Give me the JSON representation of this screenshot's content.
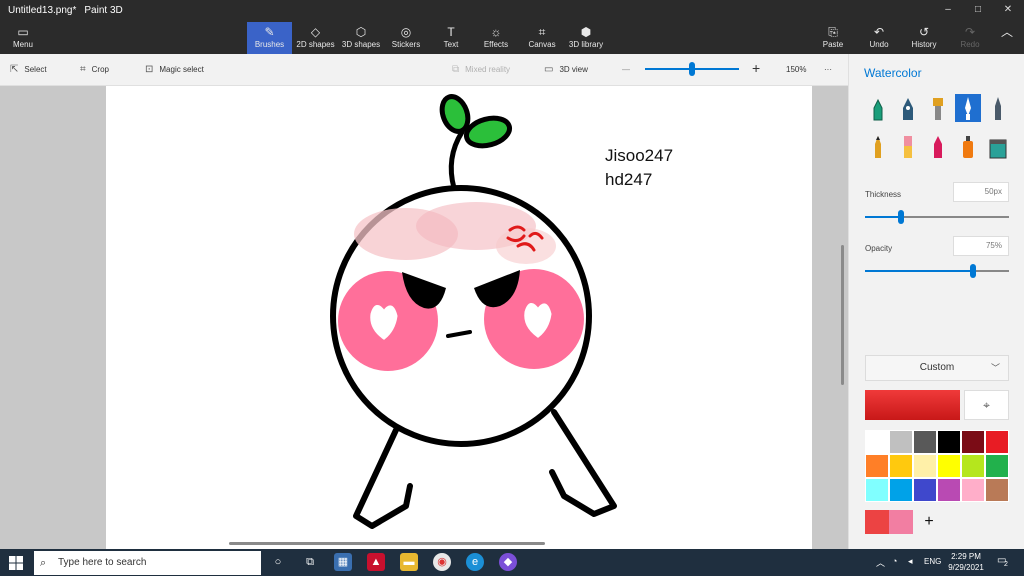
{
  "window": {
    "file_title": "Untitled13.png*",
    "app_name": "Paint 3D",
    "controls": [
      "–",
      "□",
      "✕"
    ]
  },
  "ribbon": {
    "menu": "Menu",
    "tabs": [
      {
        "label": "Brushes",
        "icon": "brush-icon"
      },
      {
        "label": "2D shapes",
        "icon": "2d-shapes-icon"
      },
      {
        "label": "3D shapes",
        "icon": "3d-shapes-icon"
      },
      {
        "label": "Stickers",
        "icon": "stickers-icon"
      },
      {
        "label": "Text",
        "icon": "text-icon"
      },
      {
        "label": "Effects",
        "icon": "effects-icon"
      },
      {
        "label": "Canvas",
        "icon": "canvas-icon"
      },
      {
        "label": "3D library",
        "icon": "3d-library-icon"
      }
    ],
    "actions": [
      {
        "label": "Paste",
        "icon": "paste-icon"
      },
      {
        "label": "Undo",
        "icon": "undo-icon"
      },
      {
        "label": "History",
        "icon": "history-icon"
      },
      {
        "label": "Redo",
        "icon": "redo-icon"
      }
    ]
  },
  "toolbar": {
    "select": "Select",
    "crop": "Crop",
    "magic_select": "Magic select",
    "mixed_reality": "Mixed reality",
    "view_3d": "3D view",
    "zoom": "150%",
    "zoom_out": "—",
    "zoom_in": "+",
    "more": "···",
    "zoom_level_fraction": 0.5
  },
  "canvas": {
    "signature_line1": "Jisoo247",
    "signature_line2": "hd247"
  },
  "panel": {
    "title": "Watercolor",
    "tools_row1": [
      "marker",
      "calligraphy-pen",
      "oil-brush",
      "watercolor",
      "pencil"
    ],
    "tools_row2": [
      "eraser-pencil",
      "crayon",
      "pixel-pen",
      "spray-can",
      "fill-bucket"
    ],
    "thickness_label": "Thickness",
    "thickness_value": "50px",
    "thickness_fraction": 0.25,
    "opacity_label": "Opacity",
    "opacity_value": "75%",
    "opacity_fraction": 0.75,
    "color_mode": "Custom",
    "selected_color": "#e82a2a",
    "palette": [
      "#ffffff",
      "#c0c0c0",
      "#595959",
      "#000000",
      "#7b0c16",
      "#e81c24",
      "#ff7f27",
      "#ffc90e",
      "#fff0a8",
      "#ffff00",
      "#b5e61d",
      "#22b14c",
      "#80ffff",
      "#00a2e8",
      "#3f48cc",
      "#b94ab3",
      "#ffaec9",
      "#b97a57"
    ],
    "recent_colors": [
      "#ec4343",
      "#f27ea2"
    ],
    "add_label": "+"
  },
  "taskbar": {
    "search_placeholder": "Type here to search",
    "language": "ENG",
    "time": "2:29 PM",
    "date": "9/29/2021",
    "notification_count": "2"
  }
}
